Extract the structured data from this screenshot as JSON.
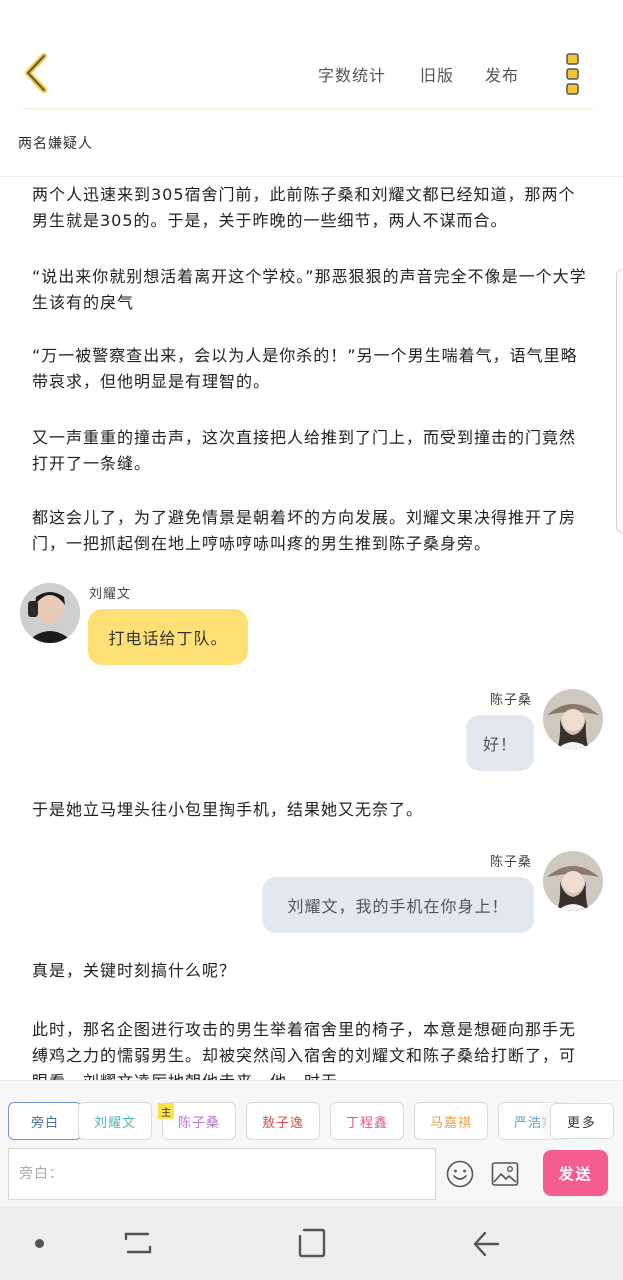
{
  "header": {
    "word_count_label": "字数统计",
    "old_version_label": "旧版",
    "publish_label": "发布",
    "accent_color": "#f2c436"
  },
  "chapter_title": "两名嫌疑人",
  "content": {
    "paragraphs": [
      "两个人迅速来到305宿舍门前，此前陈子桑和刘耀文都已经知道，那两个男生就是305的。于是，关于昨晚的一些细节，两人不谋而合。",
      "“说出来你就别想活着离开这个学校。”那恶狠狠的声音完全不像是一个大学生该有的戾气",
      "“万一被警察查出来，会以为人是你杀的！”另一个男生喘着气，语气里略带哀求，但他明显是有理智的。",
      "又一声重重的撞击声，这次直接把人给推到了门上，而受到撞击的门竟然打开了一条缝。",
      "都这会儿了，为了避免情景是朝着坏的方向发展。刘耀文果决得推开了房门，一把抓起倒在地上哼哧哼哧叫疼的男生推到陈子桑身旁。",
      "于是她立马埋头往小包里掏手机，结果她又无奈了。",
      "真是，关键时刻搞什么呢？",
      "此时，那名企图进行攻击的男生举着宿舍里的椅子，本意是想砸向那手无缚鸡之力的懦弱男生。却被突然闯入宿舍的刘耀文和陈子桑给打断了，可眼看，刘耀文凌厉地朝他走来，他一时无"
    ],
    "messages": [
      {
        "name": "刘耀文",
        "text": "打电话给丁队。"
      },
      {
        "name": "陈子桑",
        "text": "好！"
      },
      {
        "name": "陈子桑",
        "text": "刘耀文，我的手机在你身上！"
      }
    ]
  },
  "roles": {
    "items": [
      {
        "label": "旁白",
        "color": "#4a6ea8"
      },
      {
        "label": "刘耀文",
        "color": "#4fb8b0"
      },
      {
        "label": "陈子桑",
        "color": "#b678d4"
      },
      {
        "label": "敖子逸",
        "color": "#e0504a"
      },
      {
        "label": "丁程鑫",
        "color": "#e25a8c"
      },
      {
        "label": "马嘉祺",
        "color": "#e7a04d"
      },
      {
        "label": "严浩翔",
        "color": "#5aa6c8"
      }
    ],
    "lead_badge": "主",
    "more_label": "更多"
  },
  "input": {
    "placeholder": "旁白：",
    "send_label": "发送",
    "send_color": "#f45d8d"
  },
  "icons": {
    "back": "back-arrow-icon",
    "menu": "more-vertical-icon",
    "emoji": "smiley-icon",
    "image": "image-icon"
  }
}
